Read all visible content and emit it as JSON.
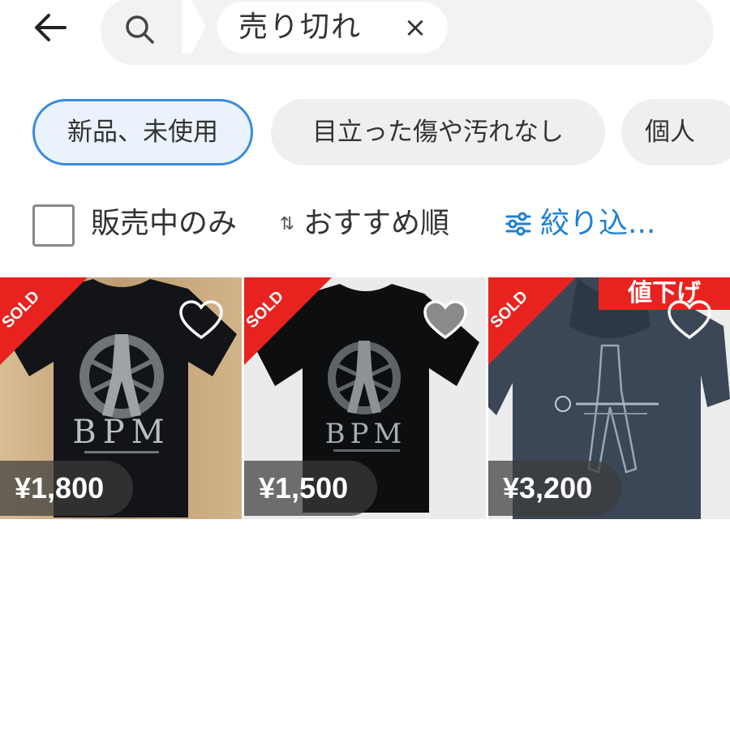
{
  "search": {
    "query": "売り切れ",
    "clear_symbol": "×"
  },
  "condition_filters": [
    {
      "label": "新品、未使用",
      "active": true
    },
    {
      "label": "目立った傷や汚れなし",
      "active": false
    },
    {
      "label": "個人",
      "active": false
    }
  ],
  "toolbar": {
    "on_sale_only_label": "販売中のみ",
    "on_sale_only_checked": false,
    "sort_icon": "⇅",
    "sort_label": "おすすめ順",
    "filter_label": "絞り込..."
  },
  "colors": {
    "accent": "#1e7fd3",
    "sold_badge": "#e8231f",
    "price_down_badge": "#e8231f"
  },
  "items": [
    {
      "price": "¥1,800",
      "sold_label": "SOLD",
      "shirt_print": "BPM",
      "price_down": ""
    },
    {
      "price": "¥1,500",
      "sold_label": "SOLD",
      "shirt_print": "BPM",
      "price_down": ""
    },
    {
      "price": "¥3,200",
      "sold_label": "SOLD",
      "shirt_print": "",
      "price_down": "値下げ"
    }
  ]
}
